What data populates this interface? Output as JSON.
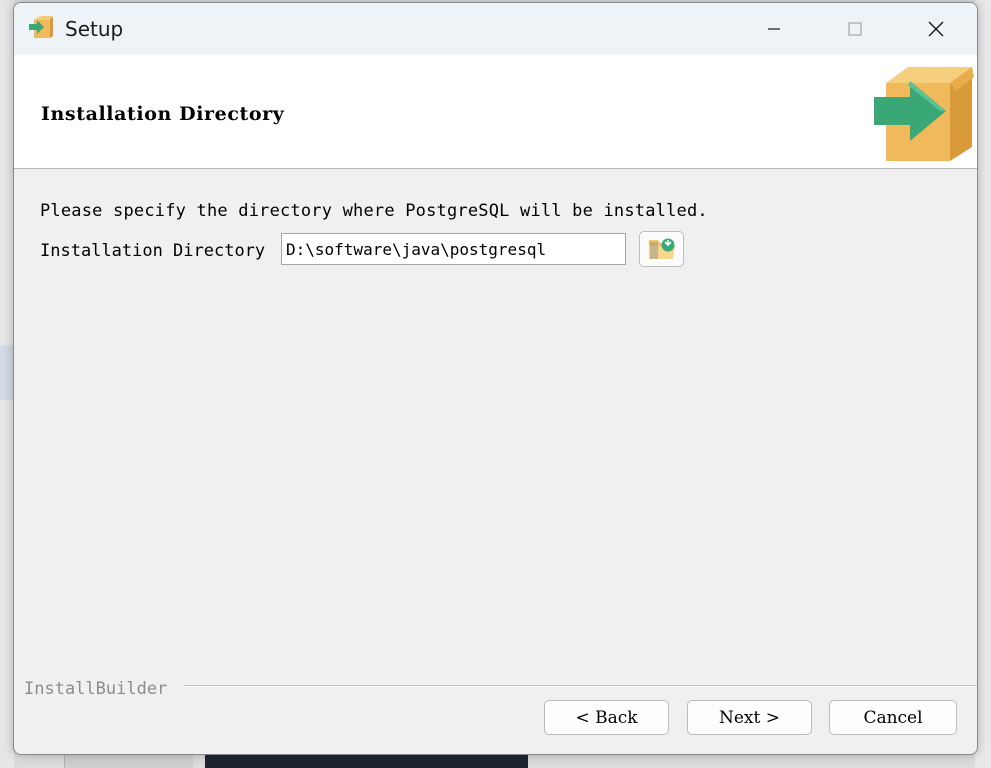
{
  "window": {
    "title": "Setup",
    "icons": {
      "app": "installer-box-icon",
      "minimize": "minimize-icon",
      "maximize": "maximize-icon",
      "close": "close-icon"
    }
  },
  "header": {
    "title": "Installation Directory",
    "logo": "installer-box-icon"
  },
  "content": {
    "description": "Please specify the directory where PostgreSQL will be installed.",
    "directory_label": "Installation Directory",
    "directory_value": "D:\\software\\java\\postgresql",
    "browse_icon": "folder-browse-icon"
  },
  "footer": {
    "brand": "InstallBuilder",
    "back_label": "< Back",
    "next_label": "Next >",
    "cancel_label": "Cancel"
  },
  "colors": {
    "box": "#f0b95c",
    "arrow": "#3aa876",
    "titlebar": "#eef3f7",
    "body": "#f0f0f0"
  }
}
